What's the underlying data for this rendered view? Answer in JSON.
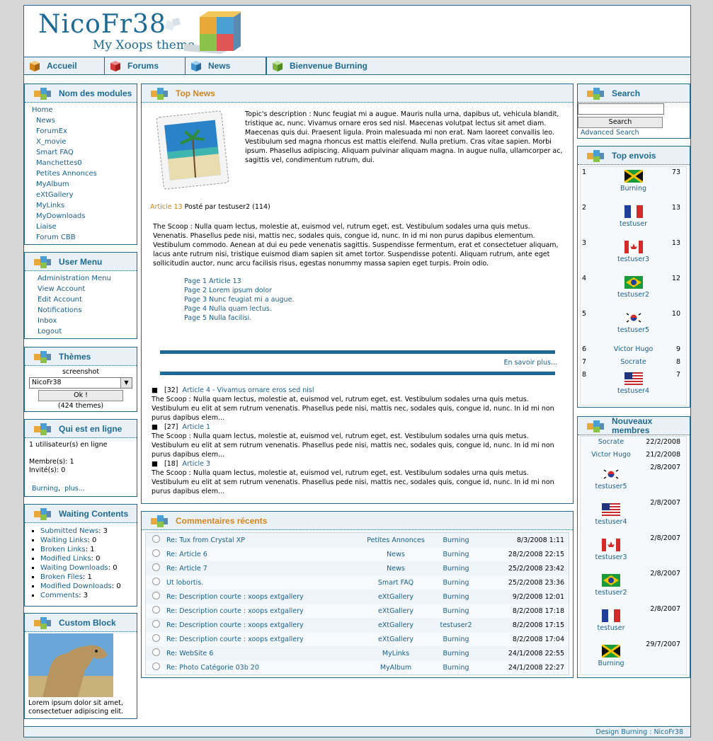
{
  "header": {
    "title": "NicoFr38",
    "subtitle": "My Xoops theme"
  },
  "nav": [
    {
      "label": "Accueil"
    },
    {
      "label": "Forums"
    },
    {
      "label": "News"
    },
    {
      "label": "Bienvenue Burning"
    }
  ],
  "modules": {
    "title": "Nom des modules",
    "items": [
      "Home",
      "News",
      "ForumEx",
      "X_movie",
      "Smart FAQ",
      "Manchettes0",
      "Petites Annonces",
      "MyAlbum",
      "eXtGallery",
      "MyLinks",
      "MyDownloads",
      "Liaise",
      "Forum CBB"
    ]
  },
  "usermenu": {
    "title": "User Menu",
    "items": [
      "Administration Menu",
      "View Account",
      "Edit Account",
      "Notifications",
      "Inbox",
      "Logout"
    ]
  },
  "themes": {
    "title": "Thèmes",
    "label": "screenshot",
    "selected": "NicoFr38",
    "button": "Ok !",
    "count": "(424 themes)"
  },
  "online": {
    "title": "Qui est en ligne",
    "line1": "1 utilisateur(s) en ligne",
    "members": "Membre(s): 1",
    "guests": "Invité(s): 0",
    "user": "Burning",
    "more": "plus..."
  },
  "waiting": {
    "title": "Waiting Contents",
    "items": [
      {
        "label": "Submitted News",
        "count": "3"
      },
      {
        "label": "Waiting Links",
        "count": "0"
      },
      {
        "label": "Broken Links",
        "count": "1"
      },
      {
        "label": "Modified Links",
        "count": "0"
      },
      {
        "label": "Waiting Downloads",
        "count": "0"
      },
      {
        "label": "Broken Files",
        "count": "1"
      },
      {
        "label": "Modified Downloads",
        "count": "0"
      },
      {
        "label": "Comments",
        "count": "3"
      }
    ]
  },
  "custom": {
    "title": "Custom Block",
    "text": "Lorem ipsum dolor sit amet, consectetuer adipiscing elit."
  },
  "topnews": {
    "title": "Top News",
    "description": "Topic's description : Nunc feugiat mi a augue. Mauris nulla urna, dapibus ut, vehicula blandit, tristique ac, nunc. Vivamus ornare eros sed nisl. Maecenas volutpat lectus sit amet diam. Maecenas quis dui. Praesent ligula. Proin malesuada mi non erat. Nam laoreet convallis leo. Vestibulum sed magna rhoncus est mattis eleifend. Nulla pretium. Cras vitae sapien. Morbi ipsum. Phasellus adipiscing. Aliquam pulvinar aliquam magna. In augue nulla, ullamcorper ac, sagittis vel, condimentum rutrum, dui.",
    "article_link": "Article 13",
    "article_meta": "Posté par testuser2 (114)",
    "scoop": "The Scoop : Nulla quam lectus, molestie at, euismod vel, rutrum eget, est. Vestibulum sodales urna quis metus. Venenatis. Phasellus pede nisi, mattis nec, sodales quis, congue id, nunc. In id mi non purus dapibus elementum. Vestibulum commodo. Aenean at dui eu pede venenatis sagittis. Suspendisse fermentum, erat et consectetuer aliquam, lacus ante rutrum nisi, tristique euismod diam sapien sit amet tortor. Suspendisse potenti. Aliquam rutrum, ante eget sollicitudin auctor, nunc arcu facilisis risus, egestas nonummy massa sapien eget turpis. Proin odio.",
    "pages": [
      "Page 1 Article 13",
      "Page 2 Lorem ipsum dolor",
      "Page 3 Nunc feugiat mi a augue.",
      "Page 4 Nulla quam lectus.",
      "Page 5 Nulla facilisi."
    ],
    "more": "En savoir plus...",
    "others": [
      {
        "count": "[32]",
        "title": "Article 4 - Vivamus ornare eros sed nisl",
        "text": "The Scoop : Nulla quam lectus, molestie at, euismod vel, rutrum eget, est. Vestibulum sodales urna quis metus. Vestibulum eu elit at sem rutrum venenatis. Phasellus pede nisi, mattis nec, sodales quis, congue id, nunc. In id mi non purus dapibus elem..."
      },
      {
        "count": "[27]",
        "title": "Article 1",
        "text": "The Scoop : Nulla quam lectus, molestie at, euismod vel, rutrum eget, est. Vestibulum sodales urna quis metus. Vestibulum eu elit at sem rutrum venenatis. Phasellus pede nisi, mattis nec, sodales quis, congue id, nunc. In id mi non purus dapibus elem..."
      },
      {
        "count": "[18]",
        "title": "Article 3",
        "text": "The Scoop : Nulla quam lectus, molestie at, euismod vel, rutrum eget, est. Vestibulum sodales urna quis metus. Vestibulum eu elit at sem rutrum venenatis. Phasellus pede nisi, mattis nec, sodales quis, congue id, nunc. In id mi non purus dapibus elem..."
      }
    ]
  },
  "comments": {
    "title": "Commentaires récents",
    "rows": [
      {
        "title": "Re: Tux from Crystal XP",
        "module": "Petites Annonces",
        "user": "Burning",
        "date": "8/3/2008 1:11"
      },
      {
        "title": "Re: Article 6",
        "module": "News",
        "user": "Burning",
        "date": "28/2/2008 22:15"
      },
      {
        "title": "Re: Article 7",
        "module": "News",
        "user": "Burning",
        "date": "25/2/2008 23:42"
      },
      {
        "title": "Ut lobortis.",
        "module": "Smart FAQ",
        "user": "Burning",
        "date": "25/2/2008 23:36"
      },
      {
        "title": "Re: Description courte : xoops extgallery",
        "module": "eXtGallery",
        "user": "Burning",
        "date": "9/2/2008 12:01"
      },
      {
        "title": "Re: Description courte : xoops extgallery",
        "module": "eXtGallery",
        "user": "Burning",
        "date": "8/2/2008 17:18"
      },
      {
        "title": "Re: Description courte : xoops extgallery",
        "module": "eXtGallery",
        "user": "testuser2",
        "date": "8/2/2008 17:15"
      },
      {
        "title": "Re: Description courte : xoops extgallery",
        "module": "eXtGallery",
        "user": "Burning",
        "date": "8/2/2008 17:04"
      },
      {
        "title": "Re: WebSite 6",
        "module": "MyLinks",
        "user": "Burning",
        "date": "24/1/2008 22:55"
      },
      {
        "title": "Re: Photo Catégorie 03b 20",
        "module": "MyAlbum",
        "user": "Burning",
        "date": "24/1/2008 22:27"
      }
    ]
  },
  "search": {
    "title": "Search",
    "button": "Search",
    "advanced": "Advanced Search"
  },
  "topenvois": {
    "title": "Top envois",
    "rows": [
      {
        "rank": "1",
        "user": "Burning",
        "count": "73",
        "flag": "jamaica"
      },
      {
        "rank": "2",
        "user": "testuser",
        "count": "13",
        "flag": "france"
      },
      {
        "rank": "3",
        "user": "testuser3",
        "count": "13",
        "flag": "canada"
      },
      {
        "rank": "4",
        "user": "testuser2",
        "count": "12",
        "flag": "brazil"
      },
      {
        "rank": "5",
        "user": "testuser5",
        "count": "10",
        "flag": "korea"
      },
      {
        "rank": "6",
        "user": "Victor Hugo",
        "count": "9",
        "flag": ""
      },
      {
        "rank": "7",
        "user": "Socrate",
        "count": "8",
        "flag": ""
      },
      {
        "rank": "8",
        "user": "testuser4",
        "count": "7",
        "flag": "usa"
      }
    ]
  },
  "newmembers": {
    "title": "Nouveaux membres",
    "rows": [
      {
        "user": "Socrate",
        "date": "22/2/2008",
        "flag": ""
      },
      {
        "user": "Victor Hugo",
        "date": "21/2/2008",
        "flag": ""
      },
      {
        "user": "testuser5",
        "date": "2/8/2007",
        "flag": "korea"
      },
      {
        "user": "testuser4",
        "date": "2/8/2007",
        "flag": "usa"
      },
      {
        "user": "testuser3",
        "date": "2/8/2007",
        "flag": "canada"
      },
      {
        "user": "testuser2",
        "date": "2/8/2007",
        "flag": "brazil"
      },
      {
        "user": "testuser",
        "date": "2/8/2007",
        "flag": "france"
      },
      {
        "user": "Burning",
        "date": "29/7/2007",
        "flag": "jamaica"
      }
    ]
  },
  "footer": {
    "text": "Design Burning : NicoFr38"
  },
  "colors": {
    "primary": "#1e6a94",
    "accent": "#d4851b",
    "light_bg": "#eaf1f6"
  }
}
